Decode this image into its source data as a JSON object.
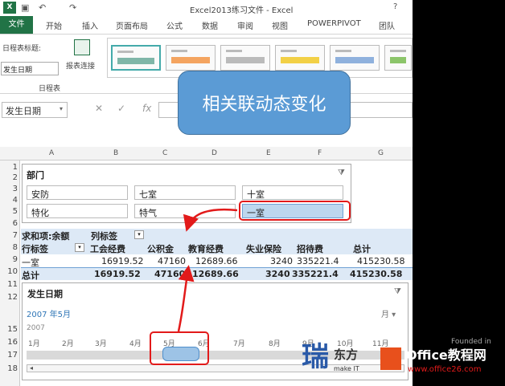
{
  "titlebar": {
    "title": "Excel2013练习文件 - Excel",
    "help": "?",
    "logo": "X"
  },
  "tabs": [
    "文件",
    "开始",
    "插入",
    "页面布局",
    "公式",
    "数据",
    "审阅",
    "视图",
    "POWERPIVOT",
    "团队"
  ],
  "ribbon": {
    "timeline_caption_label": "日程表标题:",
    "timeline_caption_value": "发生日期",
    "report_connections": "报表连接",
    "group_label": "日程表"
  },
  "formula": {
    "namebox": "发生日期",
    "cancel": "✕",
    "enter": "✓",
    "fx": "fx"
  },
  "shape_text": "相关联动态变化",
  "columns": [
    "A",
    "B",
    "C",
    "D",
    "E",
    "F",
    "G"
  ],
  "rows": [
    "1",
    "2",
    "3",
    "4",
    "5",
    "6",
    "7",
    "8",
    "9",
    "10",
    "11",
    "12",
    "15",
    "16",
    "17",
    "18"
  ],
  "slicer": {
    "title": "部门",
    "items": [
      "安防",
      "七室",
      "十室",
      "特化",
      "特气",
      "一室"
    ],
    "selected": "一室"
  },
  "pivot": {
    "r7": {
      "a": "求和项:余额",
      "b": "列标签"
    },
    "r8": {
      "a": "行标签",
      "c1": "工会经费",
      "c2": "公积金",
      "c3": "教育经费",
      "c4": "失业保险",
      "c5": "招待费",
      "c6": "总计"
    },
    "r9": {
      "a": "一室",
      "v1": "16919.52",
      "v2": "47160",
      "v3": "12689.66",
      "v4": "3240",
      "v5": "335221.4",
      "v6": "415230.58"
    },
    "r10": {
      "a": "总计",
      "v1": "16919.52",
      "v2": "47160",
      "v3": "12689.66",
      "v4": "3240",
      "v5": "335221.4",
      "v6": "415230.58"
    }
  },
  "timeline": {
    "title": "发生日期",
    "period": "2007 年5月",
    "unit": "月 ▾",
    "year": "2007",
    "months": [
      "1月",
      "2月",
      "3月",
      "4月",
      "5月",
      "6月",
      "7月",
      "8月",
      "9月",
      "10月",
      "11月"
    ]
  },
  "watermark": {
    "brand": "东方",
    "line1": "Office教程网",
    "line2": "www.office26.com",
    "founded": "Founded in",
    "make": "make IT"
  },
  "colors": {
    "accent": "#217346",
    "shape": "#5b9bd5",
    "slicer_selected": "#bdd7ee",
    "highlight": "#e21a1a"
  }
}
